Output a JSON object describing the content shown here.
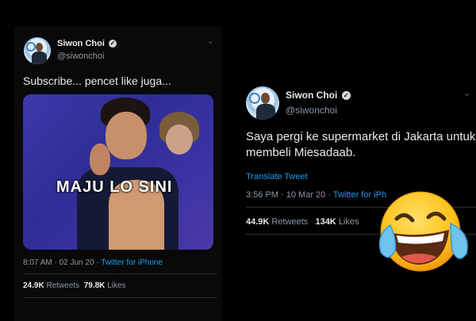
{
  "left_tweet": {
    "name": "Siwon Choi",
    "handle": "@siwonchoi",
    "text": "Subscribe... pencet like juga...",
    "media_caption": "MAJU LO SINI",
    "timestamp": "8:07 AM · 02 Jun 20 ·",
    "source": "Twitter for iPhone",
    "retweets_count": "24.9K",
    "retweets_label": "Retweets",
    "likes_count": "79.8K",
    "likes_label": "Likes"
  },
  "right_tweet": {
    "name": "Siwon Choi",
    "handle": "@siwonchoi",
    "text": "Saya pergi ke supermarket di Jakarta untuk membeli Miesadaab.",
    "translate": "Translate Tweet",
    "timestamp": "3:56 PM · 10 Mar 20 ·",
    "source": "Twitter for iPh",
    "retweets_count": "44.9K",
    "retweets_label": "Retweets",
    "likes_count": "134K",
    "likes_label": "Likes"
  },
  "icons": {
    "verified": "verified-badge-icon",
    "chevron": "chevron-down-icon",
    "emoji": "face-with-tears-of-joy"
  },
  "colors": {
    "background": "#000000",
    "link": "#1d9bf0",
    "muted": "#8b98a5",
    "text": "#e7e9ea",
    "media_purple": "#3c3aa8"
  }
}
